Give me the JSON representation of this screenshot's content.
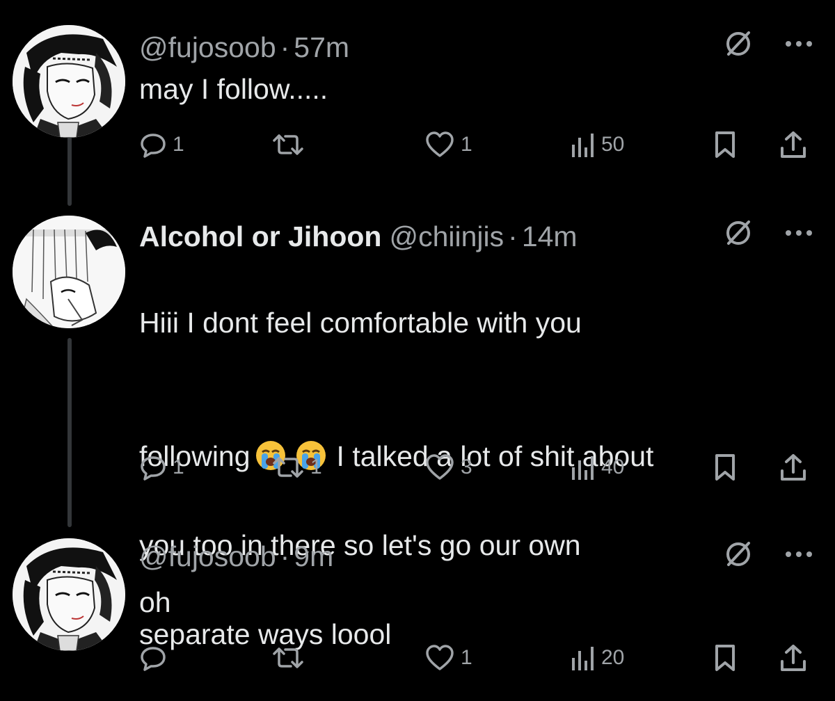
{
  "colors": {
    "background": "#000000",
    "primary_text": "#e7e9ea",
    "secondary_text": "#a0a4a8",
    "thread_line": "#333639"
  },
  "tweets": [
    {
      "display_name": "",
      "handle": "@fujosoob",
      "separator": "·",
      "time": "57m",
      "text": "may I follow.....",
      "replies": "1",
      "reposts": "",
      "likes": "1",
      "views": "50",
      "icons": [
        "avatar",
        "muted-circle-slash-icon",
        "more-icon",
        "reply-icon",
        "repost-icon",
        "like-icon",
        "views-icon",
        "bookmark-icon",
        "share-icon"
      ]
    },
    {
      "display_name": "Alcohol or Jihoon",
      "handle": "@chiinjis",
      "separator": "·",
      "time": "14m",
      "text_line1": "Hiii I dont feel comfortable with you",
      "text_line2_a": "following",
      "text_line2_b": "I talked a lot of shit about",
      "text_line3": "you too in there so let's go our own",
      "text_line4": "separate ways loool",
      "emoji": [
        "loudly-crying-face-emoji",
        "loudly-crying-face-emoji"
      ],
      "replies": "1",
      "reposts": "1",
      "likes": "3",
      "views": "40"
    },
    {
      "display_name": "",
      "handle": "@fujosoob",
      "separator": "·",
      "time": "9m",
      "text": "oh",
      "replies": "",
      "reposts": "",
      "likes": "1",
      "views": "20"
    }
  ]
}
